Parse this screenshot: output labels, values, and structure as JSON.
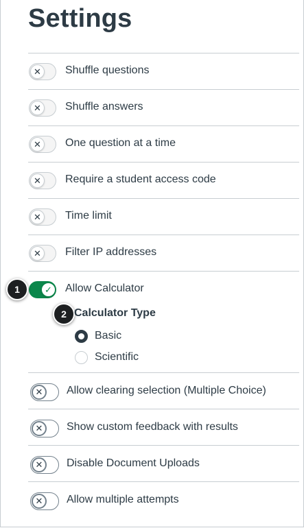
{
  "page": {
    "title": "Settings"
  },
  "settings": [
    {
      "label": "Shuffle questions",
      "state": "off"
    },
    {
      "label": "Shuffle answers",
      "state": "off"
    },
    {
      "label": "One question at a time",
      "state": "off"
    },
    {
      "label": "Require a student access code",
      "state": "off"
    },
    {
      "label": "Time limit",
      "state": "off"
    },
    {
      "label": "Filter IP addresses",
      "state": "off"
    },
    {
      "label": "Allow Calculator",
      "state": "on"
    },
    {
      "label": "Allow clearing selection (Multiple Choice)",
      "state": "off"
    },
    {
      "label": "Show custom feedback with results",
      "state": "off"
    },
    {
      "label": "Disable Document Uploads",
      "state": "off"
    },
    {
      "label": "Allow multiple attempts",
      "state": "off"
    }
  ],
  "calculator": {
    "heading": "Calculator Type",
    "options": [
      {
        "label": "Basic",
        "selected": true
      },
      {
        "label": "Scientific",
        "selected": false
      }
    ]
  },
  "callouts": {
    "one": "1",
    "two": "2"
  },
  "icons": {
    "off": "close-icon",
    "on": "checkmark-icon",
    "off_glyph": "✕",
    "on_glyph": "✓"
  },
  "colors": {
    "toggle_on": "#0b874b",
    "text": "#2d3b45",
    "divider": "#c7cdd1"
  }
}
